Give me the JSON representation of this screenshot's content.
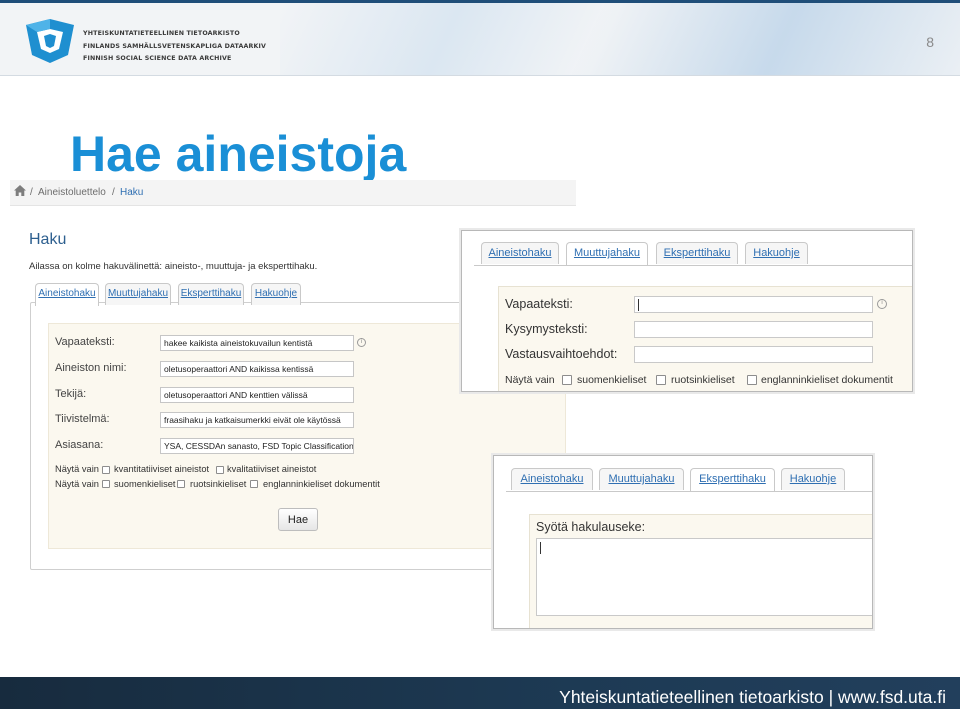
{
  "header": {
    "logo_lines": [
      "YHTEISKUNTATIETEELLINEN TIETOARKISTO",
      "FINLANDS SAMHÄLLSVETENSKAPLIGA DATAARKIV",
      "FINNISH SOCIAL SCIENCE DATA ARCHIVE"
    ],
    "page_number": "8",
    "colors": {
      "brand_blue": "#1a8fd6",
      "logo_blue": "#1f8fd0",
      "footer_navy": "#1d3a54"
    }
  },
  "slide_title": "Hae aineistoja",
  "main_screenshot": {
    "breadcrumb": {
      "home_icon": "home-icon",
      "separator": "/",
      "items": [
        "Aineistoluettelo",
        "Haku"
      ]
    },
    "heading": "Haku",
    "intro": "Ailassa on kolme hakuvälinettä: aineisto-, muuttuja- ja eksperttihaku.",
    "tabs": [
      "Aineistohaku",
      "Muuttujahaku",
      "Eksperttihaku",
      "Hakuohje"
    ],
    "active_tab": "Aineistohaku",
    "fields": [
      {
        "label": "Vapaateksti:",
        "value": "hakee kaikista aineistokuvailun kentistä"
      },
      {
        "label": "Aineiston nimi:",
        "value": "oletusoperaattori AND kaikissa kentissä"
      },
      {
        "label": "Tekijä:",
        "value": "oletusoperaattori AND kenttien välissä"
      },
      {
        "label": "Tiivistelmä:",
        "value": "fraasihaku ja katkaisumerkki eivät ole käytössä"
      },
      {
        "label": "Asiasana:",
        "value": "YSA, CESSDAn sanasto, FSD Topic Classification"
      }
    ],
    "info_icon_symbol": "i",
    "filter_rows": [
      {
        "label": "Näytä vain",
        "options": [
          "kvantitatiiviset aineistot",
          "kvalitatiiviset aineistot"
        ]
      },
      {
        "label": "Näytä vain",
        "options": [
          "suomenkieliset",
          "ruotsinkieliset",
          "englanninkieliset dokumentit"
        ]
      }
    ],
    "search_button": "Hae"
  },
  "overlay_muuttujahaku": {
    "tabs": [
      "Aineistohaku",
      "Muuttujahaku",
      "Eksperttihaku",
      "Hakuohje"
    ],
    "active_tab": "Muuttujahaku",
    "fields": [
      {
        "label": "Vapaateksti:",
        "value": ""
      },
      {
        "label": "Kysymysteksti:",
        "value": ""
      },
      {
        "label": "Vastausvaihtoehdot:",
        "value": ""
      }
    ],
    "info_icon_symbol": "i",
    "filter_row": {
      "label": "Näytä vain",
      "options": [
        "suomenkieliset",
        "ruotsinkieliset",
        "englanninkieliset dokumentit"
      ]
    }
  },
  "overlay_eksperttihaku": {
    "tabs": [
      "Aineistohaku",
      "Muuttujahaku",
      "Eksperttihaku",
      "Hakuohje"
    ],
    "active_tab": "Eksperttihaku",
    "query_label": "Syötä hakulauseke:",
    "query_value": ""
  },
  "footer": {
    "text": "Yhteiskuntatieteellinen tietoarkisto | www.fsd.uta.fi"
  }
}
